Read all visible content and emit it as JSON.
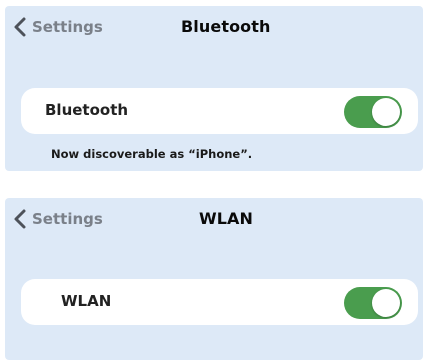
{
  "bluetooth_screen": {
    "back_label": "Settings",
    "title": "Bluetooth",
    "row_label": "Bluetooth",
    "toggle_on": true,
    "discoverable_note": "Now discoverable as “iPhone”."
  },
  "wlan_screen": {
    "back_label": "Settings",
    "title": "WLAN",
    "row_label": "WLAN",
    "toggle_on": true
  },
  "colors": {
    "panel_background": "#dde9f7",
    "toggle_on": "#4a9d4e",
    "back_text": "#7a8089"
  },
  "icons": {
    "back": "chevron-left-icon"
  }
}
